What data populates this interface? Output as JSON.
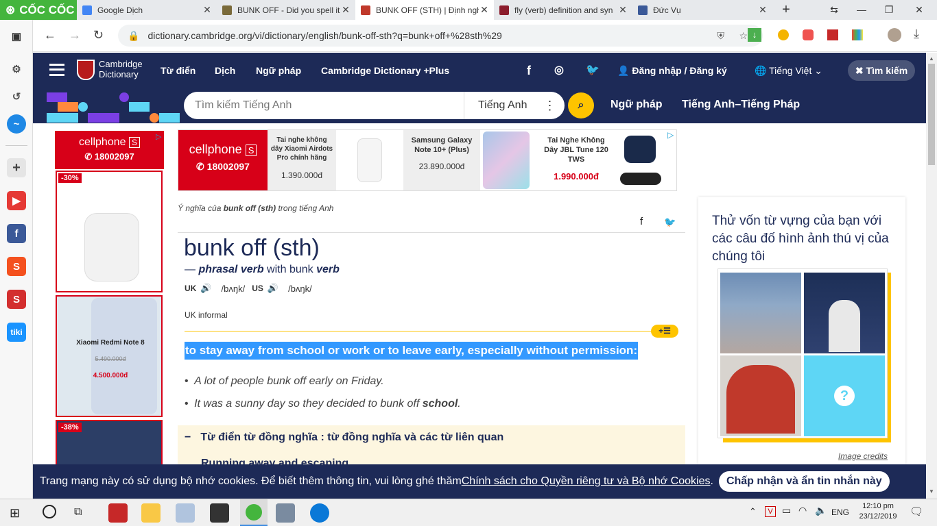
{
  "browser": {
    "logo": "CỐC CỐC",
    "tabs": [
      {
        "title": "Google Dịch",
        "color": "#4285f4"
      },
      {
        "title": "BUNK OFF - Did you spell it",
        "color": "#7a6a3a"
      },
      {
        "title": "BUNK OFF (STH) | Định nghĩa",
        "color": "#c0392b"
      },
      {
        "title": "fly (verb) definition and syn",
        "color": "#8b1c2c"
      },
      {
        "title": "Đức Vụ",
        "color": "#3b5998"
      }
    ],
    "new_tab": "+",
    "url": "dictionary.cambridge.org/vi/dictionary/english/bunk-off-sth?q=bunk+off+%28sth%29"
  },
  "site": {
    "logo_line1": "Cambridge",
    "logo_line2": "Dictionary",
    "nav": [
      "Từ điển",
      "Dịch",
      "Ngữ pháp",
      "Cambridge Dictionary +Plus"
    ],
    "login": "Đăng nhập / Đăng ký",
    "language": "Tiếng Việt",
    "search_button": "Tìm kiếm",
    "search_placeholder": "Tìm kiếm Tiếng Anh",
    "search_dict": "Tiếng Anh",
    "sub_links": [
      "Ngữ pháp",
      "Tiếng Anh–Tiếng Pháp"
    ]
  },
  "ads": {
    "brand": "cellphone",
    "brand_mark": "S",
    "phone": "18002097",
    "left": [
      {
        "badge": "-30%"
      },
      {
        "name": "Xiaomi Redmi Note 8",
        "old_price": "5.490.000đ",
        "price": "4.500.000đ"
      },
      {
        "badge": "-38%"
      }
    ],
    "top": [
      {
        "name": "Tai nghe không dây Xiaomi Airdots Pro chính hãng",
        "price": "1.390.000đ"
      },
      {
        "name": "Samsung Galaxy Note 10+ (Plus)",
        "price": "23.890.000đ"
      },
      {
        "name": "Tai Nghe Không Dây JBL Tune 120 TWS",
        "price": "1.990.000đ"
      }
    ]
  },
  "entry": {
    "breadcrumb_pre": "Ý nghĩa của ",
    "breadcrumb_word": "bunk off (sth)",
    "breadcrumb_post": " trong tiếng Anh",
    "headword": "bunk off (sth)",
    "pos_dash": "— ",
    "pos": "phrasal verb",
    "pos_with": " with bunk ",
    "pos_verb": "verb",
    "uk_label": "UK",
    "uk_ipa": "/bʌŋk/",
    "us_label": "US",
    "us_ipa": "/bʌŋk/",
    "register": "UK informal",
    "definition": "to stay away from school or work or to leave early, especially without permission:",
    "examples": [
      {
        "text": "A lot of people bunk off early on Friday.",
        "bold": ""
      },
      {
        "text": "It was a sunny day so they decided to bunk off ",
        "bold": "school",
        "tail": "."
      }
    ],
    "thesaurus_title": "Từ điển từ đồng nghĩa : từ đồng nghĩa và các từ liên quan",
    "thesaurus_item": "Running away and escaping"
  },
  "quiz": {
    "title": "Thử vốn từ vựng của bạn với các câu đố hình ảnh thú vị của chúng tôi",
    "credits": "Image credits"
  },
  "cookie": {
    "text": "Trang mạng này có sử dụng bộ nhớ cookies. Để biết thêm thông tin, vui lòng ghé thăm ",
    "link": "Chính sách cho Quyền riêng tư và Bộ nhớ Cookies",
    "end": ".",
    "button": "Chấp nhận và ẩn tin nhắn này"
  },
  "taskbar": {
    "lang": "ENG",
    "time": "12:10 pm",
    "date": "23/12/2019"
  },
  "colors": {
    "brand_navy": "#1d2a57",
    "accent_yellow": "#fec400",
    "selection": "#3399ff"
  }
}
